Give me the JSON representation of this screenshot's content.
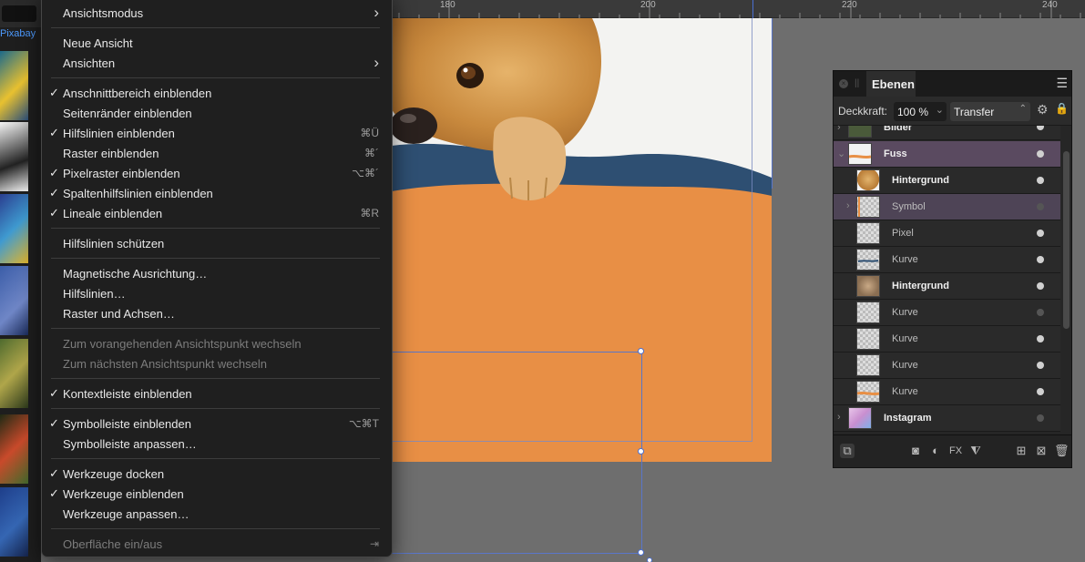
{
  "left_panel": {
    "source_label": "Pixabay"
  },
  "ruler": {
    "labels": [
      "180",
      "200",
      "220",
      "240"
    ]
  },
  "menu": {
    "items": [
      {
        "label": "Ansichtsmodus",
        "checked": false,
        "shortcut": "",
        "submenu": true,
        "disabled": false
      },
      {
        "label": "Neue Ansicht",
        "checked": false,
        "shortcut": "",
        "submenu": false,
        "disabled": false
      },
      {
        "label": "Ansichten",
        "checked": false,
        "shortcut": "",
        "submenu": true,
        "disabled": false
      },
      {
        "label": "Anschnittbereich einblenden",
        "checked": true,
        "shortcut": "",
        "submenu": false,
        "disabled": false
      },
      {
        "label": "Seitenränder einblenden",
        "checked": false,
        "shortcut": "",
        "submenu": false,
        "disabled": false
      },
      {
        "label": "Hilfslinien einblenden",
        "checked": true,
        "shortcut": "⌘Ü",
        "submenu": false,
        "disabled": false
      },
      {
        "label": "Raster einblenden",
        "checked": false,
        "shortcut": "⌘´",
        "submenu": false,
        "disabled": false
      },
      {
        "label": "Pixelraster einblenden",
        "checked": true,
        "shortcut": "⌥⌘´",
        "submenu": false,
        "disabled": false
      },
      {
        "label": "Spaltenhilfslinien einblenden",
        "checked": true,
        "shortcut": "",
        "submenu": false,
        "disabled": false
      },
      {
        "label": "Lineale einblenden",
        "checked": true,
        "shortcut": "⌘R",
        "submenu": false,
        "disabled": false
      },
      {
        "label": "Hilfslinien schützen",
        "checked": false,
        "shortcut": "",
        "submenu": false,
        "disabled": false
      },
      {
        "label": "Magnetische Ausrichtung…",
        "checked": false,
        "shortcut": "",
        "submenu": false,
        "disabled": false
      },
      {
        "label": "Hilfslinien…",
        "checked": false,
        "shortcut": "",
        "submenu": false,
        "disabled": false
      },
      {
        "label": "Raster und Achsen…",
        "checked": false,
        "shortcut": "",
        "submenu": false,
        "disabled": false
      },
      {
        "label": "Zum vorangehenden Ansichtspunkt wechseln",
        "checked": false,
        "shortcut": "",
        "submenu": false,
        "disabled": true
      },
      {
        "label": "Zum nächsten Ansichtspunkt wechseln",
        "checked": false,
        "shortcut": "",
        "submenu": false,
        "disabled": true
      },
      {
        "label": "Kontextleiste einblenden",
        "checked": true,
        "shortcut": "",
        "submenu": false,
        "disabled": false
      },
      {
        "label": "Symbolleiste einblenden",
        "checked": true,
        "shortcut": "⌥⌘T",
        "submenu": false,
        "disabled": false
      },
      {
        "label": "Symbolleiste anpassen…",
        "checked": false,
        "shortcut": "",
        "submenu": false,
        "disabled": false
      },
      {
        "label": "Werkzeuge docken",
        "checked": true,
        "shortcut": "",
        "submenu": false,
        "disabled": false
      },
      {
        "label": "Werkzeuge einblenden",
        "checked": true,
        "shortcut": "",
        "submenu": false,
        "disabled": false
      },
      {
        "label": "Werkzeuge anpassen…",
        "checked": false,
        "shortcut": "",
        "submenu": false,
        "disabled": false
      },
      {
        "label": "Oberfläche ein/aus",
        "checked": false,
        "shortcut": "⇥",
        "submenu": false,
        "disabled": true
      }
    ],
    "check_glyph": "✓",
    "submenu_glyph": "›"
  },
  "layers_panel": {
    "tab_label": "Ebenen",
    "opacity_label": "Deckkraft:",
    "opacity_value": "100 %",
    "blend_mode": "Transfer",
    "layers": [
      {
        "name": "Bilder",
        "bold": true,
        "expander": "›",
        "indent": 0,
        "thumb": "image",
        "visible": true,
        "state": ""
      },
      {
        "name": "Fuss",
        "bold": true,
        "expander": "⌄",
        "indent": 0,
        "thumb": "curve-orange",
        "visible": true,
        "state": "selected"
      },
      {
        "name": "Hintergrund",
        "bold": true,
        "expander": "",
        "indent": 1,
        "thumb": "dog",
        "visible": true,
        "state": ""
      },
      {
        "name": "Symbol",
        "bold": false,
        "expander": "›",
        "indent": 1,
        "thumb": "checker",
        "visible": false,
        "state": "selected-child"
      },
      {
        "name": "Pixel",
        "bold": false,
        "expander": "",
        "indent": 1,
        "thumb": "checker",
        "visible": true,
        "state": ""
      },
      {
        "name": "Kurve",
        "bold": false,
        "expander": "",
        "indent": 1,
        "thumb": "curve-blue",
        "visible": true,
        "state": ""
      },
      {
        "name": "Hintergrund",
        "bold": true,
        "expander": "",
        "indent": 1,
        "thumb": "cat",
        "visible": true,
        "state": ""
      },
      {
        "name": "Kurve",
        "bold": false,
        "expander": "",
        "indent": 1,
        "thumb": "checker",
        "visible": false,
        "state": ""
      },
      {
        "name": "Kurve",
        "bold": false,
        "expander": "",
        "indent": 1,
        "thumb": "checker",
        "visible": true,
        "state": ""
      },
      {
        "name": "Kurve",
        "bold": false,
        "expander": "",
        "indent": 1,
        "thumb": "checker",
        "visible": true,
        "state": ""
      },
      {
        "name": "Kurve",
        "bold": false,
        "expander": "",
        "indent": 1,
        "thumb": "curve-orange",
        "visible": true,
        "state": ""
      },
      {
        "name": "Instagram",
        "bold": true,
        "expander": "›",
        "indent": 0,
        "thumb": "instagram",
        "visible": false,
        "state": ""
      }
    ]
  },
  "colors": {
    "accent_orange": "#e88f45",
    "accent_blue": "#2e4f72",
    "guide_blue": "#5a76c8",
    "selection_purple": "#5a4a60"
  }
}
